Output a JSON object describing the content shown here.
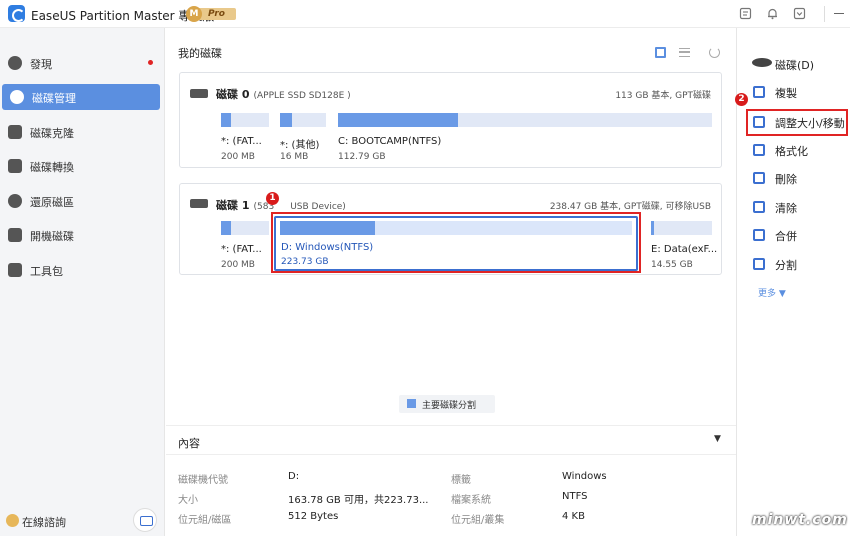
{
  "app": {
    "title": "EaseUS Partition Master 專業版",
    "badge_letter": "M",
    "badge_label": "Pro",
    "accent_color": "#5b8fe0",
    "highlight_color": "#e02424"
  },
  "sidebar": {
    "items": [
      {
        "label": "發現",
        "icon": "compass-icon"
      },
      {
        "label": "磁碟管理",
        "icon": "pie-chart-icon"
      },
      {
        "label": "磁碟克隆",
        "icon": "clone-icon"
      },
      {
        "label": "磁碟轉換",
        "icon": "convert-icon"
      },
      {
        "label": "還原磁區",
        "icon": "recover-icon"
      },
      {
        "label": "開機磁碟",
        "icon": "boot-disk-icon"
      },
      {
        "label": "工具包",
        "icon": "toolbox-icon"
      }
    ],
    "online_help": "在線諮詢"
  },
  "main": {
    "title": "我的磁碟",
    "disks": [
      {
        "name": "磁碟 0",
        "model": "(APPLE SSD SD128E )",
        "info": "113 GB 基本, GPT磁碟",
        "partitions": [
          {
            "name": "*: (FAT...",
            "size": "200 MB",
            "used_fraction": 0.2
          },
          {
            "name": "*: (其他)",
            "size": "16 MB",
            "used_fraction": 0.25
          },
          {
            "name": "C: BOOTCAMP(NTFS)",
            "size": "112.79 GB",
            "used_fraction": 0.32
          }
        ]
      },
      {
        "name": "磁碟 1",
        "model": "(583",
        "model_suffix": "USB Device)",
        "info": "238.47 GB 基本, GPT磁碟, 可移除USB",
        "partitions": [
          {
            "name": "*: (FAT...",
            "size": "200 MB",
            "used_fraction": 0.2
          },
          {
            "name": "D: Windows(NTFS)",
            "size": "223.73 GB",
            "used_fraction": 0.27
          },
          {
            "name": "E: Data(exF...",
            "size": "14.55 GB",
            "used_fraction": 0.05
          }
        ]
      }
    ],
    "legend": "主要磁碟分割",
    "properties": {
      "title": "內容",
      "rows": [
        {
          "k1": "磁碟機代號",
          "v1": "D:",
          "k2": "標籤",
          "v2": "Windows"
        },
        {
          "k1": "大小",
          "v1": "163.78 GB 可用，共223.73...",
          "k2": "檔案系統",
          "v2": "NTFS"
        },
        {
          "k1": "位元組/磁區",
          "v1": "512 Bytes",
          "k2": "位元組/叢集",
          "v2": "4 KB"
        }
      ]
    }
  },
  "right_panel": {
    "disk_label": "磁碟(D)",
    "actions": [
      {
        "label": "複製",
        "icon": "copy-icon"
      },
      {
        "label": "調整大小/移動",
        "icon": "resize-move-icon"
      },
      {
        "label": "格式化",
        "icon": "format-icon"
      },
      {
        "label": "刪除",
        "icon": "trash-icon"
      },
      {
        "label": "清除",
        "icon": "eraser-icon"
      },
      {
        "label": "合併",
        "icon": "merge-icon"
      },
      {
        "label": "分割",
        "icon": "split-icon"
      }
    ],
    "more": "更多 ▼"
  },
  "annotations": {
    "step1": "1",
    "step2": "2"
  },
  "watermark": "minwt.com"
}
